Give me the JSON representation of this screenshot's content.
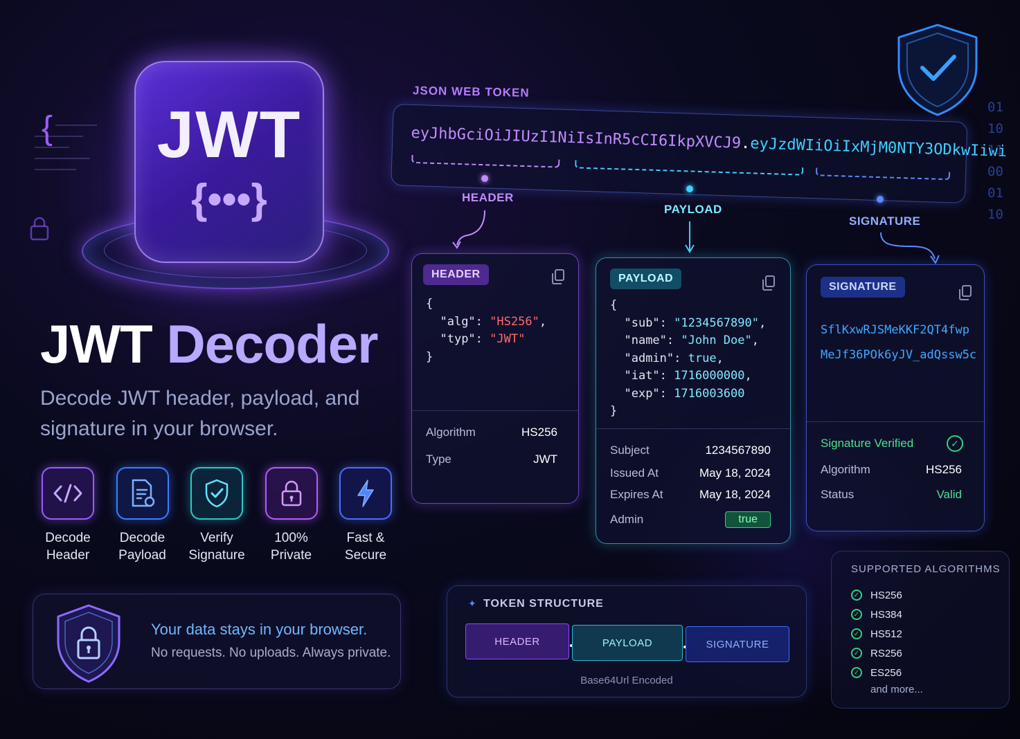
{
  "hero": {
    "logo_title": "JWT",
    "logo_braces": "{•••}",
    "title_part1": "JWT",
    "title_part2": "Decoder",
    "subtitle": "Decode JWT header, payload, and signature in your browser."
  },
  "features": [
    {
      "label": "Decode Header",
      "icon": "code-icon"
    },
    {
      "label": "Decode Payload",
      "icon": "document-icon"
    },
    {
      "label": "Verify Signature",
      "icon": "shield-check-icon"
    },
    {
      "label": "100% Private",
      "icon": "lock-icon"
    },
    {
      "label": "Fast & Secure",
      "icon": "lightning-icon"
    }
  ],
  "privacy": {
    "title": "Your data stays in your browser.",
    "text": "No requests. No uploads. Always private."
  },
  "token": {
    "label": "JSON WEB TOKEN",
    "header": "eyJhbGciOiJIUzI1NiIsInR5cCI6IkpXVCJ9",
    "dot": ".",
    "payload": "eyJzdWIiOiIxMjM0NTY3ODkwIiwi",
    "segment_labels": {
      "header": "HEADER",
      "payload": "PAYLOAD",
      "signature": "SIGNATURE"
    }
  },
  "header_card": {
    "pill": "HEADER",
    "code": {
      "open": "{",
      "alg_key": "\"alg\"",
      "alg_val": "\"HS256\"",
      "typ_key": "\"typ\"",
      "typ_val": "\"JWT\"",
      "close": "}"
    },
    "rows": [
      {
        "label": "Algorithm",
        "value": "HS256"
      },
      {
        "label": "Type",
        "value": "JWT"
      }
    ]
  },
  "payload_card": {
    "pill": "PAYLOAD",
    "code": {
      "open": "{",
      "sub_key": "\"sub\"",
      "sub_val": "\"1234567890\"",
      "name_key": "\"name\"",
      "name_val": "\"John Doe\"",
      "admin_key": "\"admin\"",
      "admin_val": "true",
      "iat_key": "\"iat\"",
      "iat_val": "1716000000",
      "exp_key": "\"exp\"",
      "exp_val": "1716003600",
      "close": "}"
    },
    "rows": [
      {
        "label": "Subject",
        "value": "1234567890"
      },
      {
        "label": "Issued At",
        "value": "May 18, 2024"
      },
      {
        "label": "Expires At",
        "value": "May 18, 2024"
      },
      {
        "label": "Admin",
        "value": "true"
      }
    ]
  },
  "signature_card": {
    "pill": "SIGNATURE",
    "line1": "SflKxwRJSMeKKF2QT4fwp",
    "line2": "MeJf36POk6yJV_adQssw5c",
    "verified": "Signature Verified",
    "rows": [
      {
        "label": "Algorithm",
        "value": "HS256"
      },
      {
        "label": "Status",
        "value": "Valid"
      }
    ]
  },
  "structure": {
    "title": "TOKEN STRUCTURE",
    "segments": [
      "HEADER",
      "PAYLOAD",
      "SIGNATURE"
    ],
    "footer": "Base64Url Encoded"
  },
  "algorithms": {
    "title": "SUPPORTED ALGORITHMS",
    "items": [
      "HS256",
      "HS384",
      "HS512",
      "RS256",
      "ES256"
    ],
    "more": "and more..."
  },
  "binary": [
    "01",
    "10",
    "11",
    "00",
    "01",
    "10"
  ],
  "colors": {
    "header": "#c38bff",
    "payload": "#3fd0ff",
    "signature": "#5f8bff",
    "success": "#2fd37a"
  }
}
